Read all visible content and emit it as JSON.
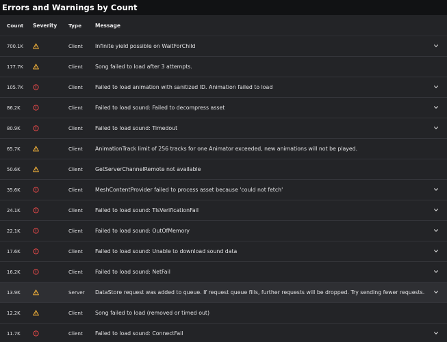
{
  "page": {
    "title": "Errors and Warnings by Count"
  },
  "table": {
    "headers": {
      "count": "Count",
      "severity": "Severity",
      "type": "Type",
      "message": "Message"
    },
    "rows": [
      {
        "count": "700.1K",
        "severity": "warning",
        "type": "Client",
        "message": "Infinite yield possible on WaitForChild",
        "expandable": true
      },
      {
        "count": "177.7K",
        "severity": "warning",
        "type": "Client",
        "message": "Song failed to load after 3 attempts.",
        "expandable": false
      },
      {
        "count": "105.7K",
        "severity": "error",
        "type": "Client",
        "message": "Failed to load animation with sanitized ID. Animation failed to load",
        "expandable": true
      },
      {
        "count": "86.2K",
        "severity": "error",
        "type": "Client",
        "message": "Failed to load sound: Failed to decompress asset",
        "expandable": true
      },
      {
        "count": "80.9K",
        "severity": "error",
        "type": "Client",
        "message": "Failed to load sound: Timedout",
        "expandable": true
      },
      {
        "count": "65.7K",
        "severity": "warning",
        "type": "Client",
        "message": "AnimationTrack limit of 256 tracks for one Animator exceeded, new animations will not be played.",
        "expandable": false
      },
      {
        "count": "50.6K",
        "severity": "warning",
        "type": "Client",
        "message": "GetServerChannelRemote not available",
        "expandable": false
      },
      {
        "count": "35.6K",
        "severity": "error",
        "type": "Client",
        "message": "MeshContentProvider failed to process asset because 'could not fetch'",
        "expandable": true
      },
      {
        "count": "24.1K",
        "severity": "error",
        "type": "Client",
        "message": "Failed to load sound: TlsVerificationFail",
        "expandable": true
      },
      {
        "count": "22.1K",
        "severity": "error",
        "type": "Client",
        "message": "Failed to load sound: OutOfMemory",
        "expandable": true
      },
      {
        "count": "17.6K",
        "severity": "error",
        "type": "Client",
        "message": "Failed to load sound: Unable to download sound data",
        "expandable": true
      },
      {
        "count": "16.2K",
        "severity": "error",
        "type": "Client",
        "message": "Failed to load sound: NetFail",
        "expandable": true
      },
      {
        "count": "13.9K",
        "severity": "warning",
        "type": "Server",
        "message": "DataStore request was added to queue. If request queue fills, further requests will be dropped. Try sending fewer requests.",
        "expandable": true,
        "highlighted": true
      },
      {
        "count": "12.2K",
        "severity": "warning",
        "type": "Client",
        "message": "Song failed to load (removed or timed out)",
        "expandable": false
      },
      {
        "count": "11.7K",
        "severity": "error",
        "type": "Client",
        "message": "Failed to load sound: ConnectFail",
        "expandable": true
      }
    ]
  },
  "colors": {
    "warning": "#f2b13a",
    "error": "#ee4a4a",
    "background": "#232427",
    "page": "#111214"
  },
  "icons": {
    "warning": "warning-icon",
    "error": "error-icon",
    "expand": "chevron-down-icon"
  }
}
